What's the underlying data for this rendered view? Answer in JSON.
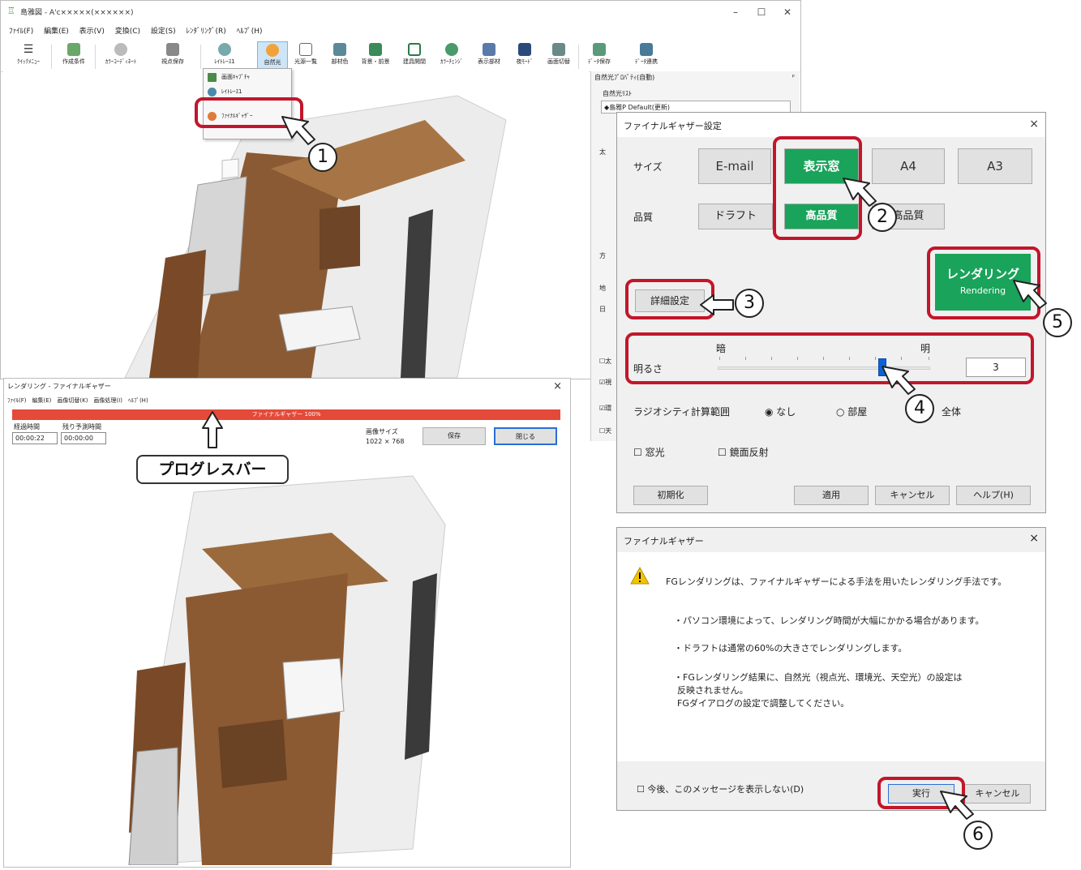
{
  "main_window": {
    "title": "島雅図 - A'c×××××(××××××)",
    "menu": [
      "ﾌｧｲﾙ(F)",
      "編集(E)",
      "表示(V)",
      "変換(C)",
      "設定(S)",
      "ﾚﾝﾀﾞﾘﾝｸﾞ(R)",
      "ﾍﾙﾌﾟ(H)"
    ],
    "toolbar": [
      "ｸｲｯｸﾒﾆｭｰ",
      "作成条件",
      "ｶﾗｰｺｰﾃﾞｨﾈｰﾄ",
      "視点保存",
      "ﾚｲﾄﾚｰｽ1",
      "自然光",
      "光源一覧",
      "部材色",
      "背景・前景",
      "建具開閉",
      "ｶﾗｰﾁｪﾝｼﾞ",
      "表示部材",
      "夜ﾓｰﾄﾞ",
      "画面切替",
      "ﾃﾞｰﾀ保存",
      "ﾃﾞｰﾀ連携"
    ],
    "dropdown": [
      "画面ｷｬﾌﾟﾁｬ",
      "ﾚｲﾄﾚｰｽ1",
      "ﾌｧｲﾅﾙｷﾞｬｻﾞｰ"
    ]
  },
  "prop_panel": {
    "header": "自然光ﾌﾟﾛﾊﾟﾃｨ(自動)",
    "list_label": "自然光ﾘｽﾄ",
    "list_value": "◆島雅P Default(更新)",
    "side_labels": [
      "太",
      "方",
      "地",
      "日"
    ],
    "checks": [
      "☐太",
      "☑視",
      "☑環",
      "☐天"
    ]
  },
  "fg_dialog": {
    "title": "ファイナルギャザー設定",
    "close": "×",
    "size_label": "サイズ",
    "size_options": [
      "E-mail",
      "表示窓",
      "A4",
      "A3"
    ],
    "quality_label": "品質",
    "quality_options": [
      "ドラフト",
      "高品質",
      "高品質"
    ],
    "render_btn_ja": "レンダリング",
    "render_btn_en": "Rendering",
    "detail_btn": "詳細設定",
    "dark": "暗",
    "light": "明",
    "brightness_label": "明るさ",
    "brightness_value": "3",
    "radiosity_label": "ラジオシティ計算範囲",
    "radio_none": "◉ なし",
    "radio_room": "○ 部屋",
    "radio_all": "全体",
    "check_window": "☐ 窓光",
    "check_mirror": "☐ 鏡面反射",
    "btn_init": "初期化",
    "btn_apply": "適用",
    "btn_cancel": "キャンセル",
    "btn_help": "ヘルプ(H)"
  },
  "render_window": {
    "title": "レンダリング - ファイナルギャザー",
    "close": "×",
    "menu": "ﾌｧｲﾙ(F)　編集(E)　画像切替(K)　画像処理(I)　ﾍﾙﾌﾟ(H)",
    "progress_text": "ファイナルギャザー 100%",
    "progress": 1.0,
    "elapsed_label": "経過時間",
    "elapsed_value": "00:00:22",
    "remain_label": "残り予測時間",
    "remain_value": "00:00:00",
    "image_size_label": "画像サイズ",
    "image_size_value": "1022 × 768",
    "save": "保存",
    "close_btn": "閉じる"
  },
  "confirm": {
    "title": "ファイナルギャザー",
    "close": "×",
    "line1": "FGレンダリングは、ファイナルギャザーによる手法を用いたレンダリング手法です。",
    "line2": "・パソコン環境によって、レンダリング時間が大幅にかかる場合があります。",
    "line3": "・ドラフトは通常の60%の大きさでレンダリングします。",
    "line4": "・FGレンダリング結果に、自然光（視点光、環境光、天空光）の設定は",
    "line5": "反映されません。",
    "line6": "FGダイアログの設定で調整してください。",
    "dont_show": "☐ 今後、このメッセージを表示しない(D)",
    "run": "実行",
    "cancel": "キャンセル"
  },
  "annotations": {
    "n1": "1",
    "n2": "2",
    "n3": "3",
    "n4": "4",
    "n5": "5",
    "n6": "6",
    "progress_callout": "プログレスバー"
  },
  "colors": {
    "accent_green": "#1aa35a",
    "highlight_red": "#c2162a",
    "progress_red": "#e44a3a",
    "slider_blue": "#0a64d8"
  }
}
